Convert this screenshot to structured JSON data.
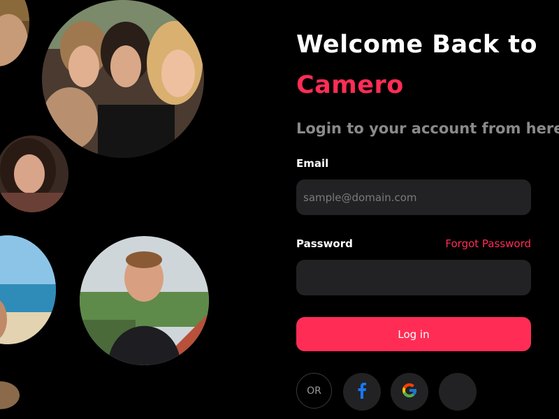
{
  "welcome": {
    "line1": "Welcome Back to",
    "brand": "Camero",
    "subtitle": "Login to your account from here"
  },
  "form": {
    "email_label": "Email",
    "email_placeholder": "sample@domain.com",
    "password_label": "Password",
    "forgot_label": "Forgot Password",
    "login_label": "Log in",
    "or_label": "OR"
  },
  "social": [
    {
      "icon": "facebook-icon"
    },
    {
      "icon": "google-icon"
    },
    {
      "icon": "apple-icon"
    }
  ],
  "colors": {
    "background": "#000000",
    "accent": "#ff2d55",
    "input_bg": "#222224",
    "subtitle": "#8a8a8a",
    "facebook": "#1877f2"
  }
}
